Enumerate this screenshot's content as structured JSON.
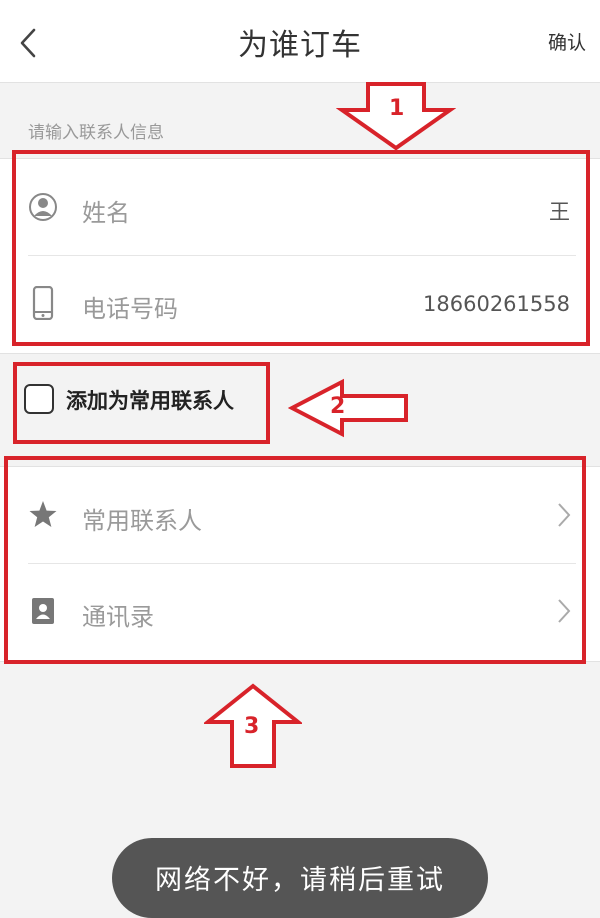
{
  "header": {
    "title": "为谁订车",
    "confirm_label": "确认"
  },
  "contact_info": {
    "section_hint": "请输入联系人信息",
    "name_label": "姓名",
    "name_value": "王",
    "phone_label": "电话号码",
    "phone_value": "18660261558"
  },
  "save_contact": {
    "label": "添加为常用联系人",
    "checked": false
  },
  "sources": {
    "frequent_contacts_label": "常用联系人",
    "address_book_label": "通讯录"
  },
  "annotations": {
    "arrow_1": "1",
    "arrow_2": "2",
    "arrow_3": "3",
    "color": "#d8232a"
  },
  "toast": {
    "message": "网络不好，请稍后重试"
  }
}
